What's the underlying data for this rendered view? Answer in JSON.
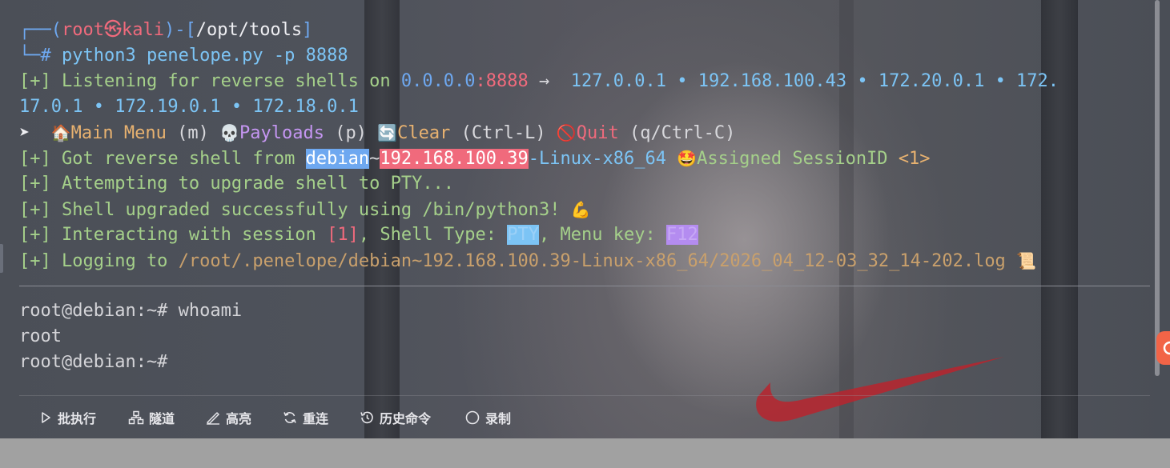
{
  "prompt": {
    "user": "root",
    "skull": "㉿",
    "host": "kali",
    "path": "/opt/tools",
    "line1_prefix": "┌──(",
    "line1_mid": ")-[",
    "line1_suffix": "]",
    "line2_prefix": "└─# ",
    "command": "python3 penelope.py -p 8888"
  },
  "output": {
    "listen_prefix": "[+] Listening for reverse shells on ",
    "listen_addr": "0.0.0.0",
    "listen_port": ":8888",
    "listen_arrow": " →  ",
    "listen_ips_1": "127.0.0.1 • 192.168.100.43 • 172.20.0.1 • 172.",
    "listen_ips_2": "17.0.1 • 172.19.0.1 • 172.18.0.1",
    "menu_arrow": "➤  ",
    "menu_main_icon": "🏠",
    "menu_main": "Main Menu",
    "menu_main_key": " (m) ",
    "menu_payloads_icon": "💀",
    "menu_payloads": "Payloads",
    "menu_payloads_key": " (p) ",
    "menu_clear_icon": "🔄",
    "menu_clear": "Clear",
    "menu_clear_key": " (Ctrl-L) ",
    "menu_quit_icon": "🚫",
    "menu_quit": "Quit",
    "menu_quit_key": " (q/Ctrl-C)",
    "got_prefix": "[+] Got reverse shell from ",
    "got_host": "debian",
    "got_tilde": "~",
    "got_ip": "192.168.100.39",
    "got_arch": "-Linux-x86_64 ",
    "got_icon": "🤩",
    "got_assigned": "Assigned SessionID ",
    "got_session": "<1>",
    "attempt": "[+] Attempting to upgrade shell to PTY...",
    "upgraded": "[+] Shell upgraded successfully using /bin/python3! ",
    "upgraded_icon": "💪",
    "interact_prefix": "[+] Interacting with session ",
    "interact_session": "[1]",
    "interact_mid": ", Shell Type: ",
    "interact_type": "PTY",
    "interact_mid2": ", Menu key: ",
    "interact_key": "F12",
    "log_prefix": "[+] Logging to ",
    "log_path": "/root/.penelope/debian~192.168.100.39-Linux-x86_64/2026_04_12-03_32_14-202.log ",
    "log_icon": "📜"
  },
  "shell": {
    "line1": "root@debian:~# whoami",
    "line2": "root",
    "line3": "root@debian:~#"
  },
  "toolbar": {
    "batch": "批执行",
    "tunnel": "隧道",
    "highlight": "高亮",
    "reconnect": "重连",
    "history": "历史命令",
    "record": "录制"
  }
}
